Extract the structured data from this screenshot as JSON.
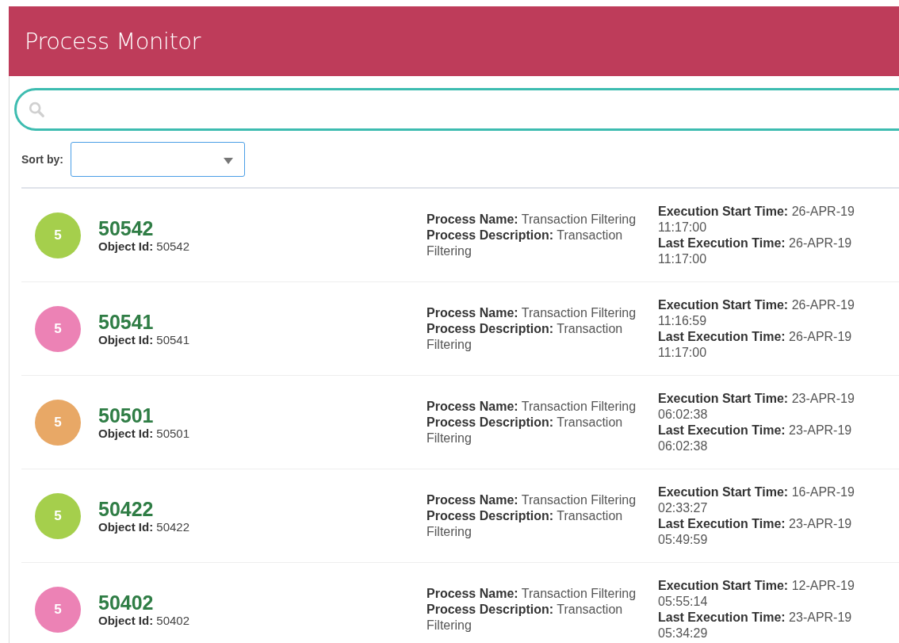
{
  "header": {
    "title": "Process Monitor"
  },
  "sort": {
    "label": "Sort by:"
  },
  "processes": [
    {
      "badge": "5",
      "color": "#a5cf4c",
      "id": "50542",
      "object_id": "**Object Id:** 50542",
      "process_name": "**Process Name:** Transaction Filtering",
      "process_description": "**Process Description:** Transaction Filtering",
      "start_time": "**Execution Start Time:** 26-APR-19 11:17:00",
      "last_time": "**Last Execution Time:** 26-APR-19 11:17:00"
    },
    {
      "badge": "5",
      "color": "#ec82b5",
      "id": "50541",
      "object_id": "**Object Id:** 50541",
      "process_name": "**Process Name:** Transaction Filtering",
      "process_description": "**Process Description:** Transaction Filtering",
      "start_time": "**Execution Start Time:** 26-APR-19 11:16:59",
      "last_time": "**Last Execution Time:** 26-APR-19 11:17:00"
    },
    {
      "badge": "5",
      "color": "#e8a866",
      "id": "50501",
      "object_id": "**Object Id:** 50501",
      "process_name": "**Process Name:** Transaction Filtering",
      "process_description": "**Process Description:** Transaction Filtering",
      "start_time": "**Execution Start Time:** 23-APR-19 06:02:38",
      "last_time": "**Last Execution Time:** 23-APR-19 06:02:38"
    },
    {
      "badge": "5",
      "color": "#a5cf4c",
      "id": "50422",
      "object_id": "**Object Id:** 50422",
      "process_name": "**Process Name:** Transaction Filtering",
      "process_description": "**Process Description:** Transaction Filtering",
      "start_time": "**Execution Start Time:** 16-APR-19 02:33:27",
      "last_time": "**Last Execution Time:** 23-APR-19 05:49:59"
    },
    {
      "badge": "5",
      "color": "#ec82b5",
      "id": "50402",
      "object_id": "**Object Id:** 50402",
      "process_name": "**Process Name:** Transaction Filtering",
      "process_description": "**Process Description:** Transaction Filtering",
      "start_time": "**Execution Start Time:** 12-APR-19 05:55:14",
      "last_time": "**Last Execution Time:** 23-APR-19 05:34:29"
    }
  ]
}
